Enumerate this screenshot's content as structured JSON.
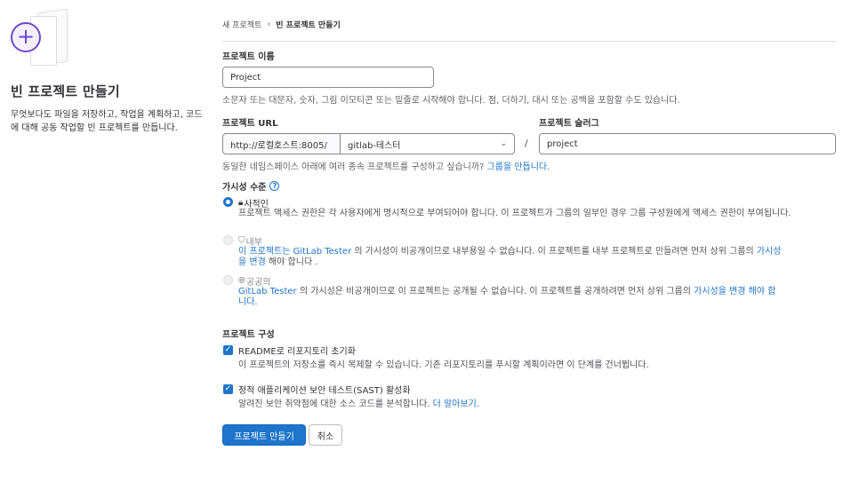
{
  "left": {
    "title": "빈 프로젝트 만들기",
    "description": "무엇보다도 파일을 저장하고, 작업을 계획하고, 코드에 대해 공동 작업할 빈 프로젝트를 만듭니다."
  },
  "breadcrumb": {
    "parent": "새 프로젝트",
    "separator": "›",
    "current": "빈 프로젝트 만들기"
  },
  "project_name": {
    "label": "프로젝트 이름",
    "value": "Project",
    "help": "소문자 또는 대문자, 숫자, 그림 이모티콘 또는 밑줄로 시작해야 합니다. 점, 더하기, 대시 또는 공백을 포함할 수도 있습니다."
  },
  "project_url": {
    "label": "프로젝트 URL",
    "base": "http://로컬호스트:8005/",
    "namespace": "gitlab-테스터",
    "slash": "/",
    "help_text": "동일한 네임스페이스 아래에 여러 종속 프로젝트를 구성하고 싶습니까?",
    "help_link": "그룹을 만듭니다."
  },
  "project_slug": {
    "label": "프로젝트 슬러그",
    "value": "project"
  },
  "visibility": {
    "label": "가시성 수준",
    "options": [
      {
        "name": "사적인",
        "desc": "프로젝트 액세스 권한은 각 사용자에게 명시적으로 부여되어야 합니다. 이 프로젝트가 그룹의 일부인 경우 그룹 구성원에게 액세스 권한이 부여됩니다.",
        "selected": true
      },
      {
        "name": "내부",
        "link1": "이 프로젝트는 GitLab Tester",
        "desc": "의 가시성이 비공개이므로 내부용일 수 없습니다. 이 프로젝트를 내부 프로젝트로 만들려면 먼저 상위 그룹의",
        "link2a": "가시성",
        "link2b": "을 변경",
        "tail": "해야 합니다 ."
      },
      {
        "name": "공공의",
        "link1": "GitLab Tester",
        "desc": "의 가시성은 비공개이므로 이 프로젝트는 공개될 수 없습니다. 이 프로젝트를 공개하려면 먼저 상위 그룹의",
        "link2a": "가시성을 변경 해야 합",
        "link2b": "니다."
      }
    ]
  },
  "config": {
    "label": "프로젝트 구성",
    "readme": {
      "title": "README로 리포지토리 초기화",
      "desc": "이 프로젝트의 저장소를 즉시 복제할 수 있습니다. 기존 리포지토리를 푸시할 계획이라면 이 단계를 건너뜁니다.",
      "checked": true
    },
    "sast": {
      "title": "정적 애플리케이션 보안 테스트(SAST) 활성화",
      "desc": "알려진 보안 취약점에 대한 소스 코드를 분석합니다.",
      "link": "더 알아보기.",
      "checked": true
    }
  },
  "actions": {
    "create": "프로젝트 만들기",
    "cancel": "취소"
  },
  "icons": {
    "plus": "plus-icon",
    "chevron": "chevron-down-icon",
    "help": "question-circle-icon",
    "lock": "lock-icon",
    "shield": "shield-icon",
    "earth": "earth-icon",
    "check": "check-icon"
  },
  "colors": {
    "accent": "#1f75cb",
    "illustration": "#6e49cb"
  }
}
